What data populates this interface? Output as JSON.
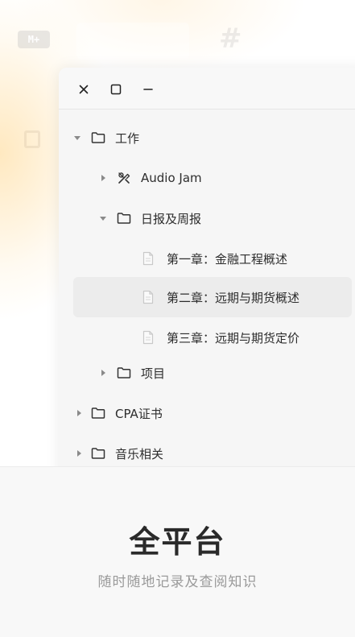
{
  "window": {
    "controls": {
      "close_icon": "close-icon",
      "maximize_icon": "maximize-icon",
      "minimize_icon": "minimize-icon"
    }
  },
  "background": {
    "md_badge": "M+",
    "hash": "#"
  },
  "tree": {
    "work": {
      "label": "工作",
      "expanded": true,
      "icon": "folder-icon"
    },
    "audio_jam": {
      "label": "Audio Jam",
      "expanded": false,
      "icon": "tools-icon"
    },
    "daily_weekly": {
      "label": "日报及周报",
      "expanded": true,
      "icon": "folder-icon"
    },
    "chapter1": {
      "label": "第一章：金融工程概述",
      "icon": "document-icon"
    },
    "chapter2": {
      "label": "第二章：远期与期货概述",
      "icon": "document-icon",
      "selected": true
    },
    "chapter3": {
      "label": "第三章：远期与期货定价",
      "icon": "document-icon"
    },
    "projects": {
      "label": "项目",
      "expanded": false,
      "icon": "folder-icon"
    },
    "cpa": {
      "label": "CPA证书",
      "expanded": false,
      "icon": "folder-icon"
    },
    "music": {
      "label": "音乐相关",
      "expanded": false,
      "icon": "folder-icon"
    }
  },
  "promo": {
    "title": "全平台",
    "subtitle": "随时随地记录及查阅知识"
  },
  "colors": {
    "selected_row": "#ececec",
    "window_bg": "#f6f6f6",
    "glow": "#ffd68c",
    "subtitle": "#9a9a9a"
  }
}
